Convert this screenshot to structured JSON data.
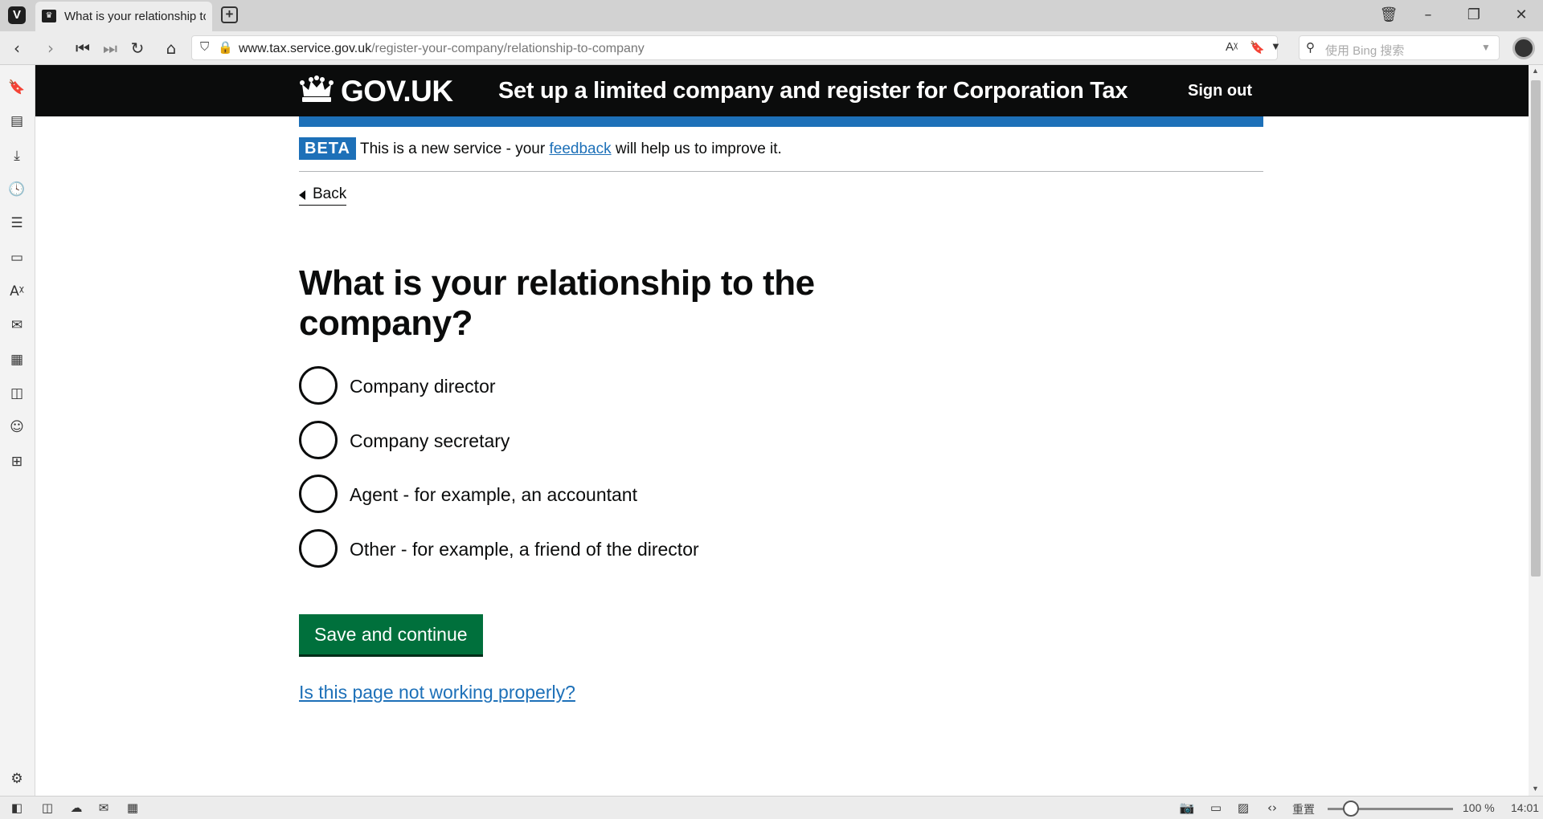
{
  "browser": {
    "tab_title": "What is your relationship to",
    "url_host": "www.tax.service.gov.uk",
    "url_path": "/register-your-company/relationship-to-company",
    "search_placeholder": "使用 Bing 搜索",
    "reset_label": "重置",
    "zoom_level": "100 %",
    "clock": "14:01"
  },
  "header": {
    "logo_text": "GOV.UK",
    "service_name": "Set up a limited company and register for Corporation Tax",
    "sign_out": "Sign out"
  },
  "phase_banner": {
    "tag": "BETA",
    "text_before": "This is a new service - your ",
    "link": "feedback",
    "text_after": " will help us to improve it."
  },
  "back_link": "Back",
  "question": "What is your relationship to the company?",
  "options": [
    {
      "label": "Company director"
    },
    {
      "label": "Company secretary"
    },
    {
      "label": "Agent - for example, an accountant"
    },
    {
      "label": "Other - for example, a friend of the director"
    }
  ],
  "save_button": "Save and continue",
  "problem_link": "Is this page not working properly?"
}
